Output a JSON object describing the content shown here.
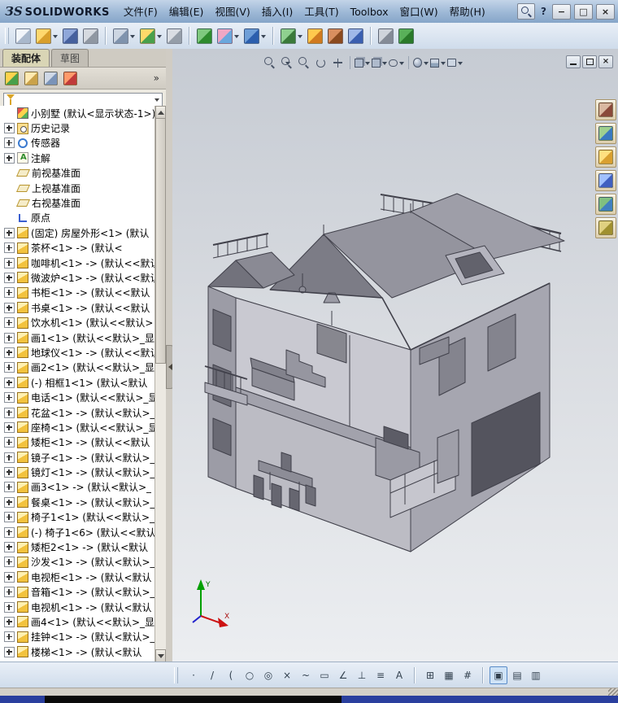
{
  "titlebar": {
    "brand_mark": "ЗS",
    "brand": "SOLIDWORKS",
    "menus": [
      "文件(F)",
      "编辑(E)",
      "视图(V)",
      "插入(I)",
      "工具(T)",
      "Toolbox",
      "窗口(W)",
      "帮助(H)"
    ],
    "help_glyph": "?",
    "controls": {
      "minimize": "−",
      "maximize": "□",
      "close": "×"
    }
  },
  "main_toolbar": {
    "icons": [
      {
        "name": "new-document",
        "c1": "#f2f5fa",
        "c2": "#a9b8cc"
      },
      {
        "name": "open",
        "c1": "#ffd86e",
        "c2": "#d99f2b",
        "caret": true
      },
      {
        "name": "save",
        "c1": "#8fa7d9",
        "c2": "#46619e"
      },
      {
        "name": "attachment",
        "c1": "#d6dae0",
        "c2": "#8f97a2"
      },
      {
        "sep": true
      },
      {
        "name": "make-drawing",
        "c1": "#cdd6e2",
        "c2": "#7f93ad",
        "caret": true
      },
      {
        "name": "make-assembly",
        "c1": "#ffd96a",
        "c2": "#49a04b",
        "caret": true
      },
      {
        "name": "print",
        "c1": "#d9dde3",
        "c2": "#959ea9"
      },
      {
        "sep": true
      },
      {
        "name": "rebuild",
        "c1": "#7fc97f",
        "c2": "#2e8b2e"
      },
      {
        "name": "edit-color",
        "c1": "#f0a7c4",
        "c2": "#6aa7dd",
        "caret": true
      },
      {
        "name": "sketch",
        "c1": "#6f9fd8",
        "c2": "#2b5fae",
        "caret": true
      },
      {
        "sep": true
      },
      {
        "name": "assembly-tools",
        "c1": "#8fd08f",
        "c2": "#3a7a3a",
        "caret": true
      },
      {
        "name": "exploded-view",
        "c1": "#ffc94d",
        "c2": "#d07a20"
      },
      {
        "name": "interference-check",
        "c1": "#d98f5f",
        "c2": "#8a4a1f"
      },
      {
        "name": "measure",
        "c1": "#9fb8e8",
        "c2": "#3a5fb0"
      },
      {
        "sep": true
      },
      {
        "name": "options",
        "c1": "#cfd4db",
        "c2": "#848b96"
      },
      {
        "name": "toolbox-library",
        "c1": "#59b059",
        "c2": "#2a7a2a"
      }
    ]
  },
  "left_panel": {
    "tabs": [
      {
        "label": "装配体"
      },
      {
        "label": "草图"
      }
    ],
    "overflow_chevron": "»",
    "manager_icons": [
      {
        "name": "feature-manager",
        "c1": "#ffd24d",
        "c2": "#49a04b"
      },
      {
        "name": "property-manager",
        "c1": "#ffe9b0",
        "c2": "#caa24a"
      },
      {
        "name": "configuration-manager",
        "c1": "#cfd8e6",
        "c2": "#7a93b8"
      },
      {
        "name": "display-manager",
        "c1": "#ff9a6a",
        "c2": "#c03a3a"
      }
    ],
    "tree": [
      {
        "icon": "assembly",
        "label": "小别墅  (默认<显示状态-1>)",
        "expand": false
      },
      {
        "icon": "history",
        "label": "历史记录",
        "expand": true
      },
      {
        "icon": "sensor",
        "label": "传感器",
        "expand": true
      },
      {
        "icon": "annotation",
        "label": "注解",
        "expand": true
      },
      {
        "icon": "plane",
        "label": "前视基准面",
        "expand": false
      },
      {
        "icon": "plane",
        "label": "上视基准面",
        "expand": false
      },
      {
        "icon": "plane",
        "label": "右视基准面",
        "expand": false
      },
      {
        "icon": "origin",
        "label": "原点",
        "expand": false
      },
      {
        "icon": "component",
        "label": "(固定) 房屋外形<1> (默认",
        "expand": true
      },
      {
        "icon": "component",
        "label": "茶杯<1> -> (默认<",
        "expand": true
      },
      {
        "icon": "component",
        "label": "咖啡机<1> -> (默认<<默认",
        "expand": true
      },
      {
        "icon": "component",
        "label": "微波炉<1> -> (默认<<默认",
        "expand": true
      },
      {
        "icon": "component",
        "label": "书柜<1> -> (默认<<默认",
        "expand": true
      },
      {
        "icon": "component",
        "label": "书桌<1> -> (默认<<默认",
        "expand": true
      },
      {
        "icon": "component",
        "label": "饮水机<1> (默认<<默认>",
        "expand": true
      },
      {
        "icon": "component",
        "label": "画1<1> (默认<<默认>_显示",
        "expand": true
      },
      {
        "icon": "component",
        "label": "地球仪<1> -> (默认<<默认",
        "expand": true
      },
      {
        "icon": "component",
        "label": "画2<1> (默认<<默认>_显示",
        "expand": true
      },
      {
        "icon": "component",
        "label": "(-) 相框1<1> (默认<默认",
        "expand": true
      },
      {
        "icon": "component",
        "label": "电话<1> (默认<<默认>_显",
        "expand": true
      },
      {
        "icon": "component",
        "label": "花盆<1> -> (默认<默认>_",
        "expand": true
      },
      {
        "icon": "component",
        "label": "座椅<1> (默认<<默认>_显",
        "expand": true
      },
      {
        "icon": "component",
        "label": "矮柜<1> -> (默认<<默认",
        "expand": true
      },
      {
        "icon": "component",
        "label": "镜子<1> -> (默认<默认>_",
        "expand": true
      },
      {
        "icon": "component",
        "label": "镜灯<1> -> (默认<默认>_",
        "expand": true
      },
      {
        "icon": "component",
        "label": "画3<1> -> (默认<默认>_",
        "expand": true
      },
      {
        "icon": "component",
        "label": "餐桌<1> -> (默认<默认>_",
        "expand": true
      },
      {
        "icon": "component",
        "label": "椅子1<1> (默认<<默认>_显",
        "expand": true
      },
      {
        "icon": "component",
        "label": "(-) 椅子1<6> (默认<<默认",
        "expand": true
      },
      {
        "icon": "component",
        "label": "矮柜2<1> -> (默认<默认",
        "expand": true
      },
      {
        "icon": "component",
        "label": "沙发<1> -> (默认<默认>_",
        "expand": true
      },
      {
        "icon": "component",
        "label": "电视柜<1> -> (默认<默认",
        "expand": true
      },
      {
        "icon": "component",
        "label": "音箱<1> -> (默认<默认>_",
        "expand": true
      },
      {
        "icon": "component",
        "label": "电视机<1> -> (默认<默认",
        "expand": true
      },
      {
        "icon": "component",
        "label": "画4<1> (默认<<默认>_显示",
        "expand": true
      },
      {
        "icon": "component",
        "label": "挂钟<1> -> (默认<默认>_",
        "expand": true
      },
      {
        "icon": "component",
        "label": "楼梯<1> -> (默认<默认",
        "expand": true
      }
    ]
  },
  "viewport": {
    "toolbar": [
      {
        "name": "zoom-to-fit",
        "kind": "mag"
      },
      {
        "name": "zoom-to-area",
        "kind": "mag",
        "caret": true
      },
      {
        "name": "zoom-in-out",
        "kind": "mag"
      },
      {
        "name": "rotate-view",
        "kind": "rotate"
      },
      {
        "name": "pan",
        "kind": "pan"
      },
      {
        "sep": true
      },
      {
        "name": "view-orientation",
        "kind": "cube",
        "caret": true
      },
      {
        "name": "display-style",
        "kind": "cube",
        "caret": true
      },
      {
        "name": "hide-show-items",
        "kind": "eye",
        "caret": true
      },
      {
        "sep": true
      },
      {
        "name": "edit-appearance",
        "kind": "sphere",
        "caret": true
      },
      {
        "name": "apply-scene",
        "kind": "scene",
        "caret": true
      },
      {
        "name": "view-settings",
        "kind": "camera",
        "caret": true
      }
    ],
    "doc_controls": {
      "close": "×"
    }
  },
  "task_pane": {
    "buttons": [
      {
        "name": "solidworks-resources",
        "c1": "#d9b8a0",
        "c2": "#8a4a3a"
      },
      {
        "name": "design-library",
        "c1": "#9fd08f",
        "c2": "#3a7ac0"
      },
      {
        "name": "file-explorer",
        "c1": "#ffe080",
        "c2": "#d9a030"
      },
      {
        "name": "search-results",
        "c1": "#a0c0ff",
        "c2": "#4060c0"
      },
      {
        "name": "view-palette",
        "c1": "#80c080",
        "c2": "#4080c0"
      },
      {
        "name": "appearances-scenes",
        "c1": "#e0d080",
        "c2": "#a09030"
      }
    ]
  },
  "bottom_toolbar": {
    "groups": [
      {
        "icons": [
          {
            "name": "sketch-point",
            "glyph": "·"
          },
          {
            "name": "sketch-line",
            "glyph": "/"
          },
          {
            "name": "sketch-arc",
            "glyph": "("
          },
          {
            "name": "sketch-circle",
            "glyph": "○"
          },
          {
            "name": "sketch-perimeter-circle",
            "glyph": "◎"
          },
          {
            "name": "sketch-trim",
            "glyph": "×"
          },
          {
            "name": "sketch-spline",
            "glyph": "~"
          },
          {
            "name": "sketch-rectangle",
            "glyph": "▭"
          },
          {
            "name": "sketch-angle",
            "glyph": "∠"
          },
          {
            "name": "sketch-relations",
            "glyph": "⊥"
          },
          {
            "name": "sketch-pattern",
            "glyph": "≡"
          },
          {
            "name": "sketch-text",
            "glyph": "A"
          }
        ]
      },
      {
        "icons": [
          {
            "name": "grid-settings",
            "glyph": "⊞"
          },
          {
            "name": "grid-display",
            "glyph": "▦"
          },
          {
            "name": "snap-settings",
            "glyph": "#"
          }
        ]
      },
      {
        "icons": [
          {
            "name": "shaded-with-edges",
            "glyph": "▣",
            "active": true
          },
          {
            "name": "section-display",
            "glyph": "▤"
          },
          {
            "name": "display-panes",
            "glyph": "▥"
          }
        ]
      }
    ]
  },
  "triad": {
    "axis_x": "X",
    "axis_y": "Y"
  },
  "colors": {
    "titlebar_top": "#c3d4e8",
    "titlebar_bottom": "#86a5c8",
    "toolbar_top": "#e9eff7",
    "toolbar_bottom": "#cfdceb",
    "panel_chrome": "#d6d2c9",
    "tree_bg": "#ffffff",
    "viewport_top": "#c6cbd3",
    "viewport_bottom": "#eceef1",
    "model_gray": "#a6a6b0",
    "taskbar_blue": "#2a3f9e",
    "triad_x": "#cc1111",
    "triad_y": "#00a000",
    "triad_z": "#2222cc"
  }
}
